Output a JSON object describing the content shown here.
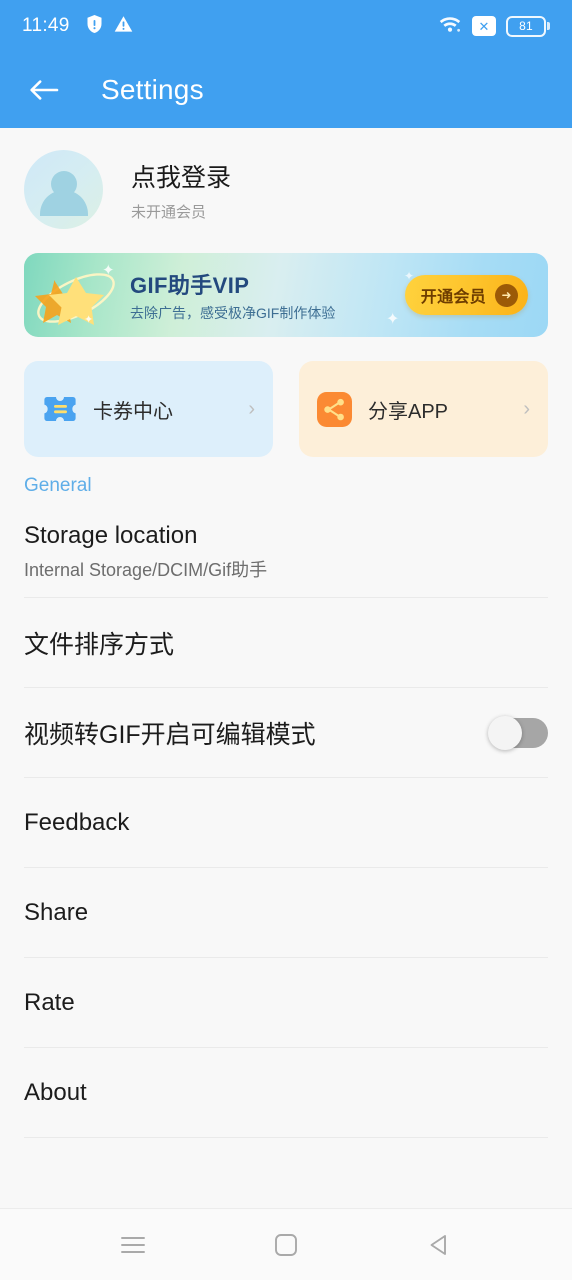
{
  "status_bar": {
    "time": "11:49",
    "battery_level": "81",
    "icons": [
      "shield-warning-icon",
      "warning-triangle-icon",
      "wifi-icon",
      "sim-disabled-icon",
      "battery-icon"
    ]
  },
  "app_bar": {
    "back_icon": "back-arrow-icon",
    "title": "Settings"
  },
  "profile": {
    "name": "点我登录",
    "subtitle": "未开通会员",
    "avatar_icon": "default-avatar-icon"
  },
  "vip_banner": {
    "title": "GIF助手VIP",
    "subtitle": "去除广告，感受极净GIF制作体验",
    "cta_label": "开通会员",
    "cta_arrow_icon": "arrow-right-icon",
    "star_icon": "star-orbit-icon",
    "gradient_from": "#7FD8BE",
    "gradient_to": "#9CD8F5",
    "cta_color": "#FDC32B"
  },
  "quick_cards": [
    {
      "label": "卡券中心",
      "icon": "ticket-icon",
      "bg": "#DDEFFB",
      "chevron": "›"
    },
    {
      "label": "分享APP",
      "icon": "share-nodes-icon",
      "bg": "#FDEFD9",
      "chevron": "›"
    }
  ],
  "section": {
    "general_label": "General",
    "general_color": "#5FAEE8"
  },
  "settings_rows": [
    {
      "title": "Storage location",
      "subtitle": "Internal Storage/DCIM/Gif助手",
      "type": "text"
    },
    {
      "title": "文件排序方式",
      "subtitle": "",
      "type": "text"
    },
    {
      "title": "视频转GIF开启可编辑模式",
      "subtitle": "",
      "type": "toggle",
      "toggle_on": false
    },
    {
      "title": "Feedback",
      "subtitle": "",
      "type": "text"
    },
    {
      "title": "Share",
      "subtitle": "",
      "type": "text"
    },
    {
      "title": "Rate",
      "subtitle": "",
      "type": "text"
    },
    {
      "title": "About",
      "subtitle": "",
      "type": "text"
    }
  ],
  "nav_bar": {
    "recents_icon": "menu-icon",
    "home_icon": "home-square-icon",
    "back_icon": "back-triangle-icon"
  }
}
